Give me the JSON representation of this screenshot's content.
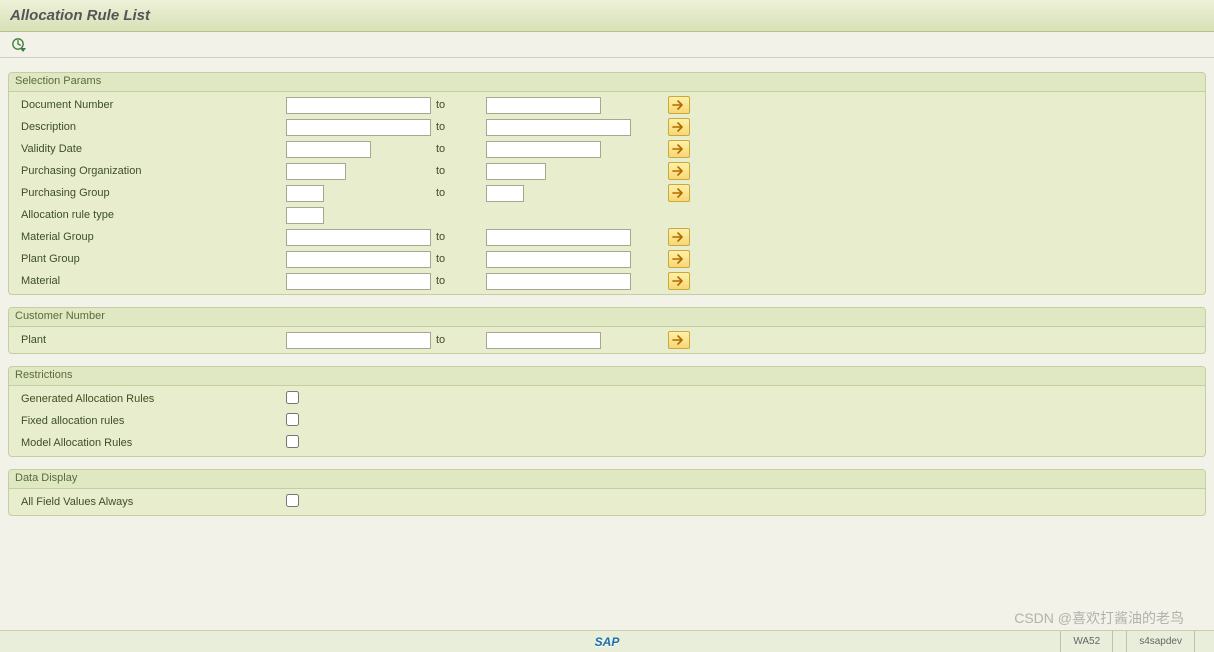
{
  "title": "Allocation Rule List",
  "groups": {
    "selection": {
      "header": "Selection Params",
      "rows": [
        {
          "label": "Document Number",
          "to": "to",
          "fromW": "w-full",
          "toW": "w-to-full",
          "multi": true
        },
        {
          "label": "Description",
          "to": "to",
          "fromW": "w-full",
          "toW": "w-full",
          "multi": true,
          "fromWide": true,
          "toWide": true
        },
        {
          "label": "Validity Date",
          "to": "to",
          "fromW": "w-med",
          "toW": "w-to-full",
          "multi": true
        },
        {
          "label": "Purchasing Organization",
          "to": "to",
          "fromW": "w-sm",
          "toW": "w-sm",
          "multi": true
        },
        {
          "label": "Purchasing Group",
          "to": "to",
          "fromW": "w-xs",
          "toW": "w-xs",
          "multi": true
        },
        {
          "label": "Allocation rule type",
          "to": "",
          "fromW": "w-xs",
          "toW": "",
          "multi": false
        },
        {
          "label": "Material Group",
          "to": "to",
          "fromW": "w-full",
          "toW": "w-full",
          "multi": true,
          "fromWide": true,
          "toWide": true
        },
        {
          "label": "Plant Group",
          "to": "to",
          "fromW": "w-full",
          "toW": "w-full",
          "multi": true,
          "fromWide": true,
          "toWide": true
        },
        {
          "label": "Material",
          "to": "to",
          "fromW": "w-full",
          "toW": "w-full",
          "multi": true,
          "fromWide": true,
          "toWide": true
        }
      ]
    },
    "customer": {
      "header": "Customer Number",
      "rows": [
        {
          "label": "Plant",
          "to": "to",
          "fromW": "w-full",
          "toW": "w-to-full",
          "multi": true
        }
      ]
    },
    "restrictions": {
      "header": "Restrictions",
      "checks": [
        {
          "label": "Generated Allocation Rules"
        },
        {
          "label": "Fixed allocation rules"
        },
        {
          "label": "Model Allocation Rules"
        }
      ]
    },
    "display": {
      "header": "Data Display",
      "checks": [
        {
          "label": "All Field Values Always"
        }
      ]
    }
  },
  "footer": {
    "sap": "SAP",
    "tcode": "WA52",
    "system": "s4sapdev"
  },
  "watermark": "CSDN @喜欢打酱油的老鸟"
}
